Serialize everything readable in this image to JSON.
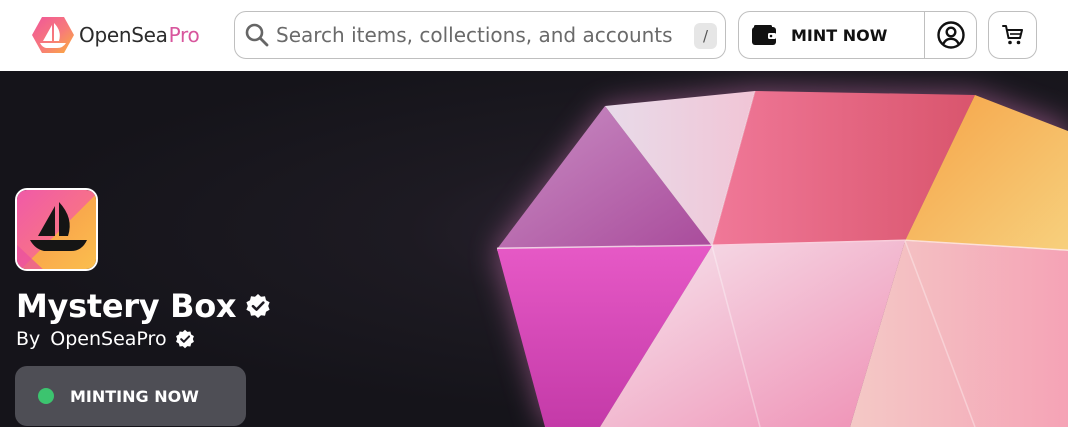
{
  "header": {
    "logo": {
      "name": "OpenSea",
      "suffix": "Pro",
      "icon": "opensea-pro-logo-icon",
      "suffix_color": "#d8569d"
    },
    "search": {
      "placeholder": "Search items, collections, and accounts",
      "value": "",
      "shortcut": "/",
      "icon": "search-icon"
    },
    "mint_button": {
      "label": "MINT NOW",
      "icon": "wallet-icon"
    },
    "account_button": {
      "icon": "account-icon"
    },
    "cart_button": {
      "icon": "cart-icon"
    }
  },
  "hero": {
    "avatar_icon": "opensea-ship-icon",
    "title": "Mystery Box",
    "title_verified_icon": "verified-badge-icon",
    "creator_prefix": "By",
    "creator_name": "OpenSeaPro",
    "creator_verified_icon": "verified-badge-icon",
    "status": {
      "label": "MINTING NOW",
      "dot_color": "#3cc46f"
    }
  },
  "colors": {
    "hero_background": "#17161b",
    "status_pill": "#5f5f66",
    "border": "#bfbfbf"
  }
}
